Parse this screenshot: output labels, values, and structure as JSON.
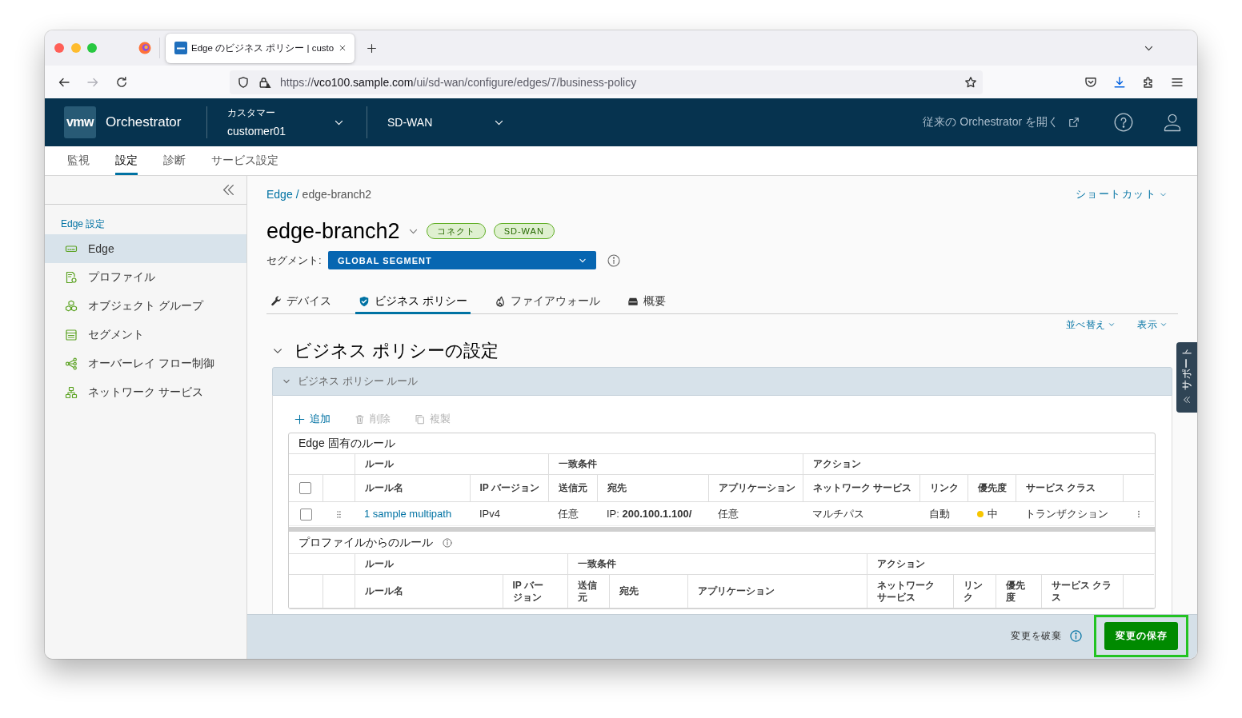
{
  "browser": {
    "tab_title": "Edge のビジネス ポリシー | custo",
    "url": {
      "scheme": "https://",
      "host": "vco100.sample.com",
      "path": "/ui/sd-wan/configure/edges/7/business-policy"
    },
    "forward_disabled": true
  },
  "header": {
    "logo": "vmw",
    "product": "Orchestrator",
    "customer": {
      "label": "カスタマー",
      "value": "customer01"
    },
    "service": "SD-WAN",
    "legacy_link": "従来の Orchestrator を開く"
  },
  "nav_tabs": [
    {
      "label": "監視",
      "selected": false
    },
    {
      "label": "設定",
      "selected": true
    },
    {
      "label": "診断",
      "selected": false
    },
    {
      "label": "サービス設定",
      "selected": false
    }
  ],
  "sidebar": {
    "heading": "Edge 設定",
    "items": [
      {
        "label": "Edge",
        "selected": true
      },
      {
        "label": "プロファイル",
        "selected": false
      },
      {
        "label": "オブジェクト グループ",
        "selected": false
      },
      {
        "label": "セグメント",
        "selected": false
      },
      {
        "label": "オーバーレイ フロー制御",
        "selected": false
      },
      {
        "label": "ネットワーク サービス",
        "selected": false
      }
    ]
  },
  "breadcrumb": {
    "link": "Edge",
    "separator": "/",
    "current": "edge-branch2"
  },
  "shortcut_menu": "ショートカット",
  "edge": {
    "name": "edge-branch2",
    "badges": [
      "コネクト",
      "SD-WAN"
    ]
  },
  "segment": {
    "label": "セグメント:",
    "value": "GLOBAL SEGMENT"
  },
  "tabs": [
    {
      "label": "デバイス",
      "selected": false
    },
    {
      "label": "ビジネス ポリシー",
      "selected": true
    },
    {
      "label": "ファイアウォール",
      "selected": false
    },
    {
      "label": "概要",
      "selected": false
    }
  ],
  "list_menus": [
    "並べ替え",
    "表示"
  ],
  "section": {
    "title": "ビジネス ポリシーの設定",
    "expanded": true
  },
  "panel": {
    "title": "ビジネス ポリシー ルール",
    "expanded": true
  },
  "toolbar": [
    {
      "label": "追加",
      "disabled": false
    },
    {
      "label": "削除",
      "disabled": true
    },
    {
      "label": "複製",
      "disabled": true
    }
  ],
  "tables": [
    {
      "title": "Edge 固有のルール",
      "info": false,
      "select_all": {
        "checked": false
      },
      "groups": [
        {
          "label": "ルール",
          "columns": [
            "ルール名",
            "IP バージョン"
          ]
        },
        {
          "label": "一致条件",
          "columns": [
            "送信元",
            "宛先",
            "アプリケーション"
          ]
        },
        {
          "label": "アクション",
          "columns": [
            "ネットワーク サービス",
            "リンク",
            "優先度",
            "サービス クラス"
          ]
        }
      ],
      "rows": [
        {
          "selected": false,
          "cells": [
            {
              "kind": "link",
              "text": "1 sample multipath"
            },
            {
              "kind": "text",
              "text": "IPv4"
            },
            {
              "kind": "text",
              "text": "任意"
            },
            {
              "kind": "text",
              "text": "IP: **200.100.1.100/**"
            },
            {
              "kind": "text",
              "text": "任意"
            },
            {
              "kind": "text",
              "text": "マルチパス"
            },
            {
              "kind": "text",
              "text": "自動"
            },
            {
              "kind": "dot",
              "text": "中",
              "color": "#f7c600"
            },
            {
              "kind": "text",
              "text": "トランザクション"
            }
          ]
        }
      ]
    },
    {
      "title": "プロファイルからのルール",
      "info": true,
      "groups": [
        {
          "label": "ルール",
          "columns": [
            "ルール名",
            "IP バージョン"
          ]
        },
        {
          "label": "一致条件",
          "columns": [
            "送信元",
            "宛先",
            "アプリケーション"
          ]
        },
        {
          "label": "アクション",
          "columns": [
            "ネットワークサービス",
            "リンク",
            "優先度",
            "サービス クラス"
          ]
        }
      ]
    }
  ],
  "footer": {
    "discard": "変更を破棄",
    "save": {
      "label": "変更の保存",
      "highlighted": true
    }
  },
  "support_tab": "サポート"
}
